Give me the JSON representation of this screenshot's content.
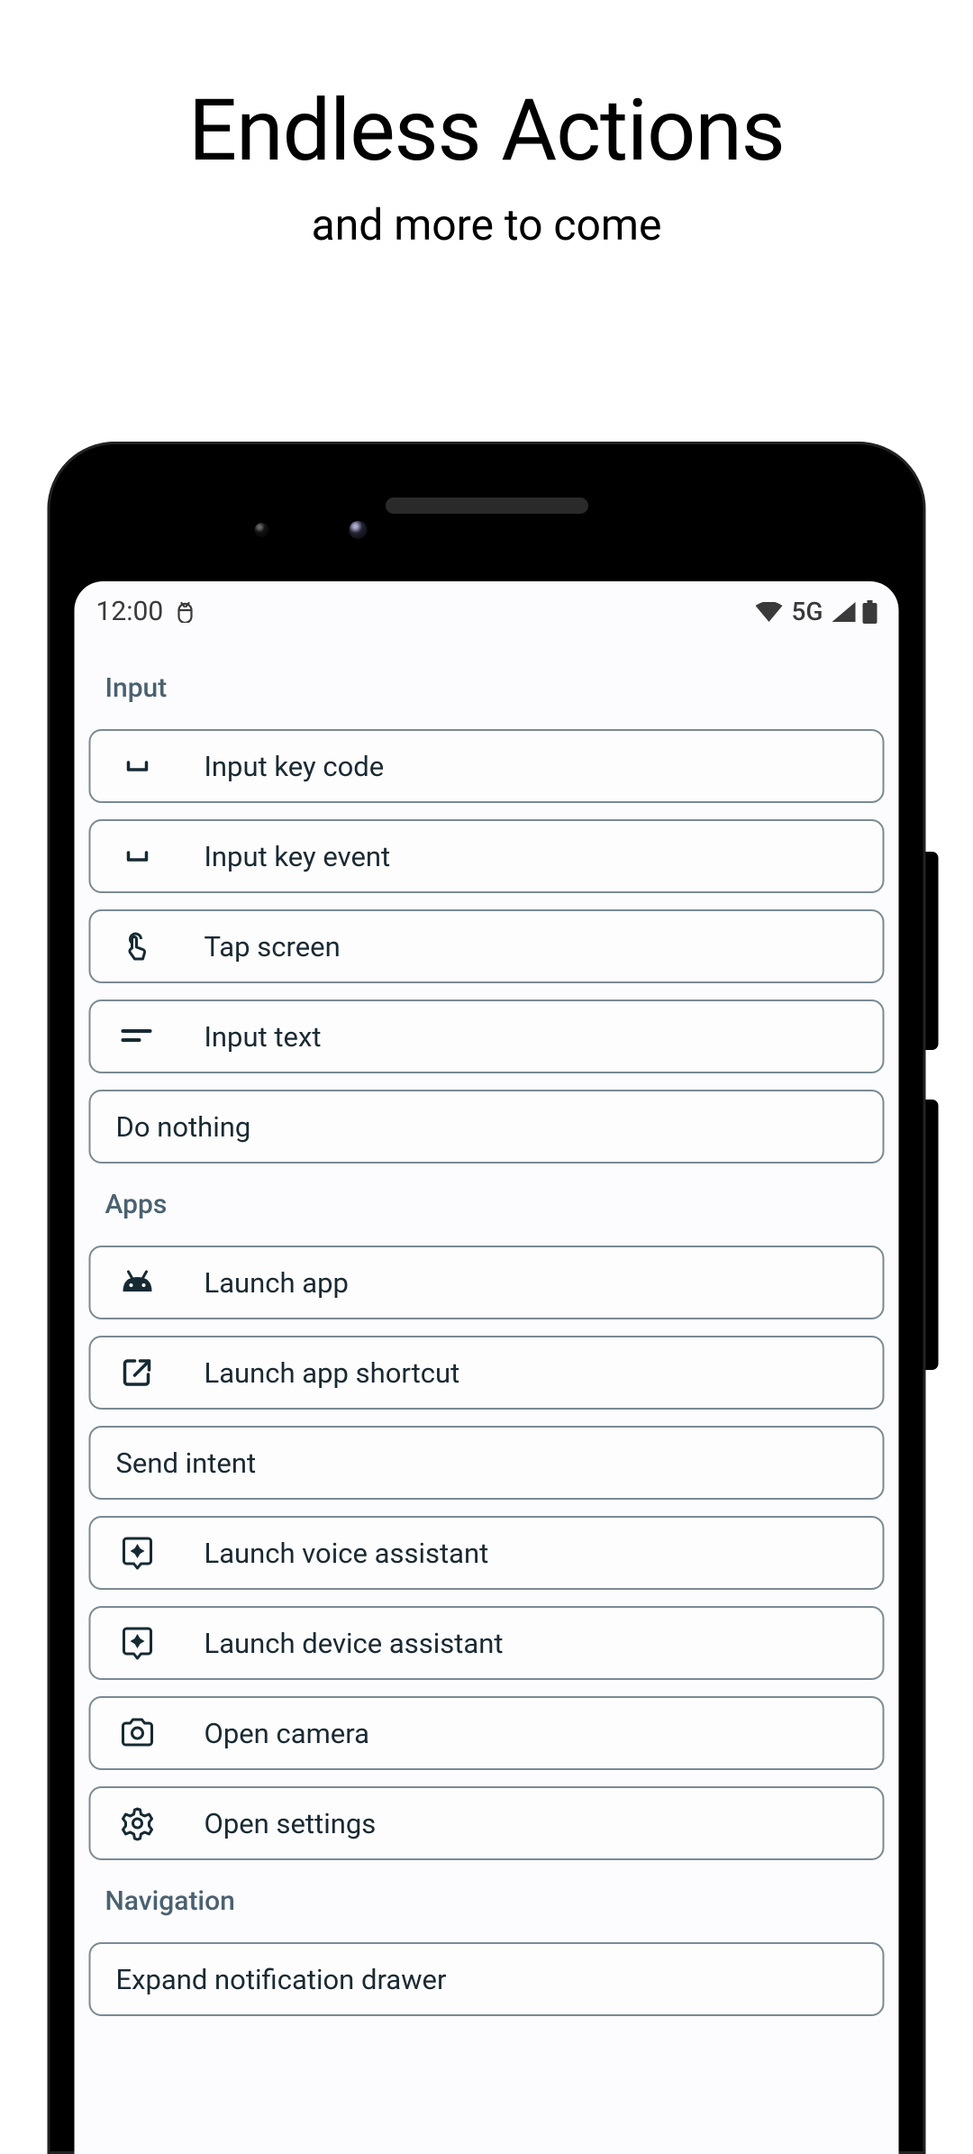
{
  "header": {
    "title": "Endless Actions",
    "subtitle": "and more to come"
  },
  "status_bar": {
    "time": "12:00",
    "network_label": "5G"
  },
  "sections": [
    {
      "title": "Input",
      "items": [
        {
          "icon": "space-bar",
          "label": "Input key code"
        },
        {
          "icon": "space-bar",
          "label": "Input key event"
        },
        {
          "icon": "touch-app",
          "label": "Tap screen"
        },
        {
          "icon": "short-text",
          "label": "Input text"
        },
        {
          "icon": null,
          "label": "Do nothing"
        }
      ]
    },
    {
      "title": "Apps",
      "items": [
        {
          "icon": "android",
          "label": "Launch app"
        },
        {
          "icon": "open-in-new",
          "label": "Launch app shortcut"
        },
        {
          "icon": null,
          "label": "Send intent"
        },
        {
          "icon": "assistant-badge",
          "label": "Launch voice assistant"
        },
        {
          "icon": "assistant-badge",
          "label": "Launch device assistant"
        },
        {
          "icon": "camera",
          "label": "Open camera"
        },
        {
          "icon": "settings",
          "label": "Open settings"
        }
      ]
    },
    {
      "title": "Navigation",
      "items": [
        {
          "icon": null,
          "label": "Expand notification drawer"
        }
      ]
    }
  ]
}
